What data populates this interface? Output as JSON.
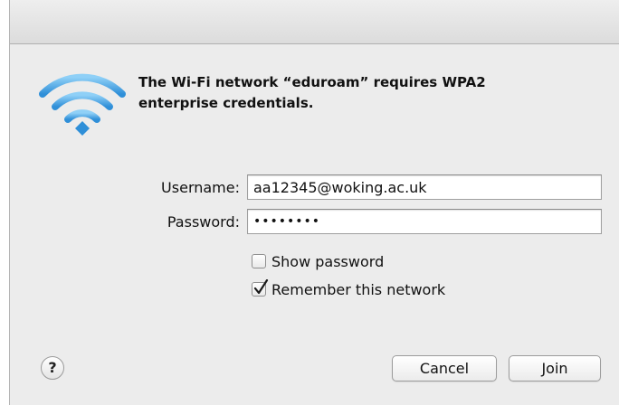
{
  "dialog": {
    "message": "The Wi-Fi network “eduroam” requires WPA2 enterprise credentials."
  },
  "form": {
    "username_label": "Username:",
    "username_value": "aa12345@woking.ac.uk",
    "password_label": "Password:",
    "password_display": "••••••••"
  },
  "options": {
    "show_password_label": "Show password",
    "show_password_checked": false,
    "remember_network_label": "Remember this network",
    "remember_network_checked": true
  },
  "buttons": {
    "help": "?",
    "cancel": "Cancel",
    "join": "Join"
  },
  "icons": {
    "wifi": "wifi-icon",
    "checkmark": "checkmark-icon"
  },
  "colors": {
    "wifi_blue": "#3d9be0",
    "dialog_bg": "#ececec"
  }
}
